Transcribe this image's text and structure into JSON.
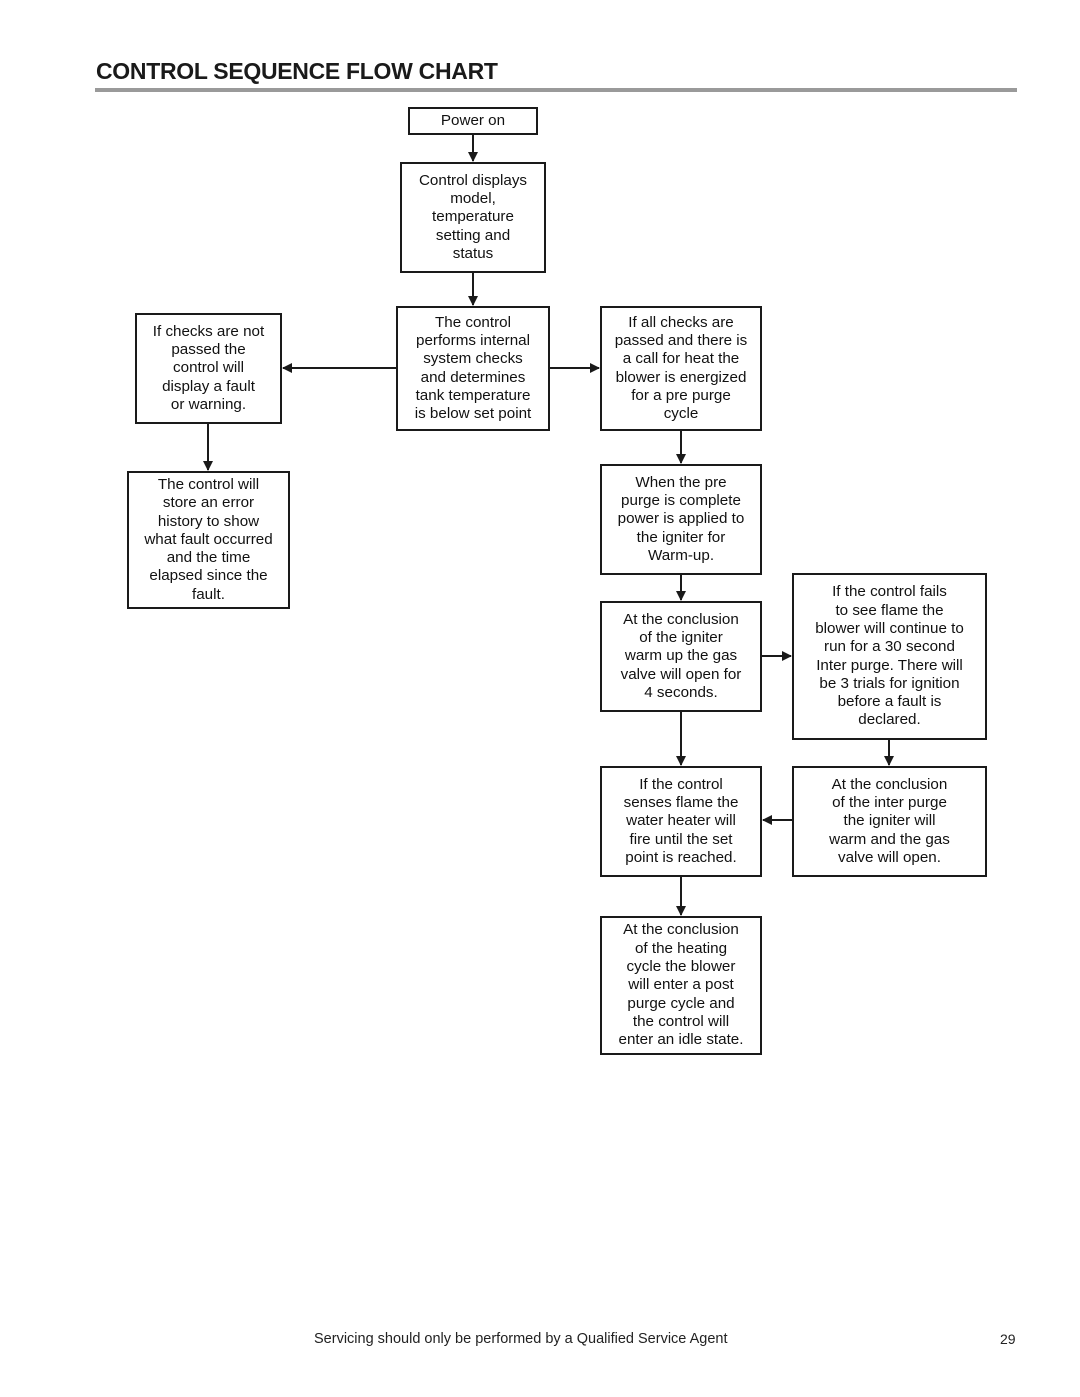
{
  "page": {
    "title": "CONTROL SEQUENCE FLOW CHART",
    "footer_text": "Servicing should only be performed by a Qualified Service Agent",
    "page_number": "29"
  },
  "flowchart": {
    "nodes": {
      "power_on": "Power on",
      "display": "Control displays\nmodel,\ntemperature\nsetting and\nstatus",
      "checks": "The control\nperforms internal\nsystem checks\nand determines\ntank temperature\nis below set point",
      "fault": "If checks are not\npassed the\ncontrol will\ndisplay a fault\nor warning.",
      "history": "The control will\nstore an error\nhistory to show\nwhat fault occurred\nand the time\nelapsed since the\nfault.",
      "pre_purge": "If all checks are\npassed and there is\na call for heat the\nblower is energized\nfor a pre purge\ncycle",
      "warmup": "When the pre\npurge is complete\npower is applied to\nthe igniter for\nWarm-up.",
      "gas_valve": "At the conclusion\nof the igniter\nwarm up the gas\nvalve will open for\n4 seconds.",
      "fail_flame": "If the control fails\nto see flame the\nblower will continue to\nrun for a 30 second\nInter purge. There will\nbe 3 trials for ignition\nbefore a fault is\ndeclared.",
      "senses_flame": "If the control\nsenses flame the\nwater heater will\nfire until the set\npoint is reached.",
      "inter_purge_end": "At the conclusion\nof the inter purge\nthe igniter will\nwarm and the gas\nvalve will open.",
      "post_purge": "At the conclusion\nof the heating\ncycle the blower\nwill enter a post\npurge cycle and\nthe control will\nenter an idle state."
    },
    "edges": [
      [
        "power_on",
        "display"
      ],
      [
        "display",
        "checks"
      ],
      [
        "checks",
        "fault"
      ],
      [
        "checks",
        "pre_purge"
      ],
      [
        "fault",
        "history"
      ],
      [
        "pre_purge",
        "warmup"
      ],
      [
        "warmup",
        "gas_valve"
      ],
      [
        "gas_valve",
        "fail_flame"
      ],
      [
        "gas_valve",
        "senses_flame"
      ],
      [
        "fail_flame",
        "inter_purge_end"
      ],
      [
        "inter_purge_end",
        "senses_flame"
      ],
      [
        "senses_flame",
        "post_purge"
      ]
    ]
  }
}
